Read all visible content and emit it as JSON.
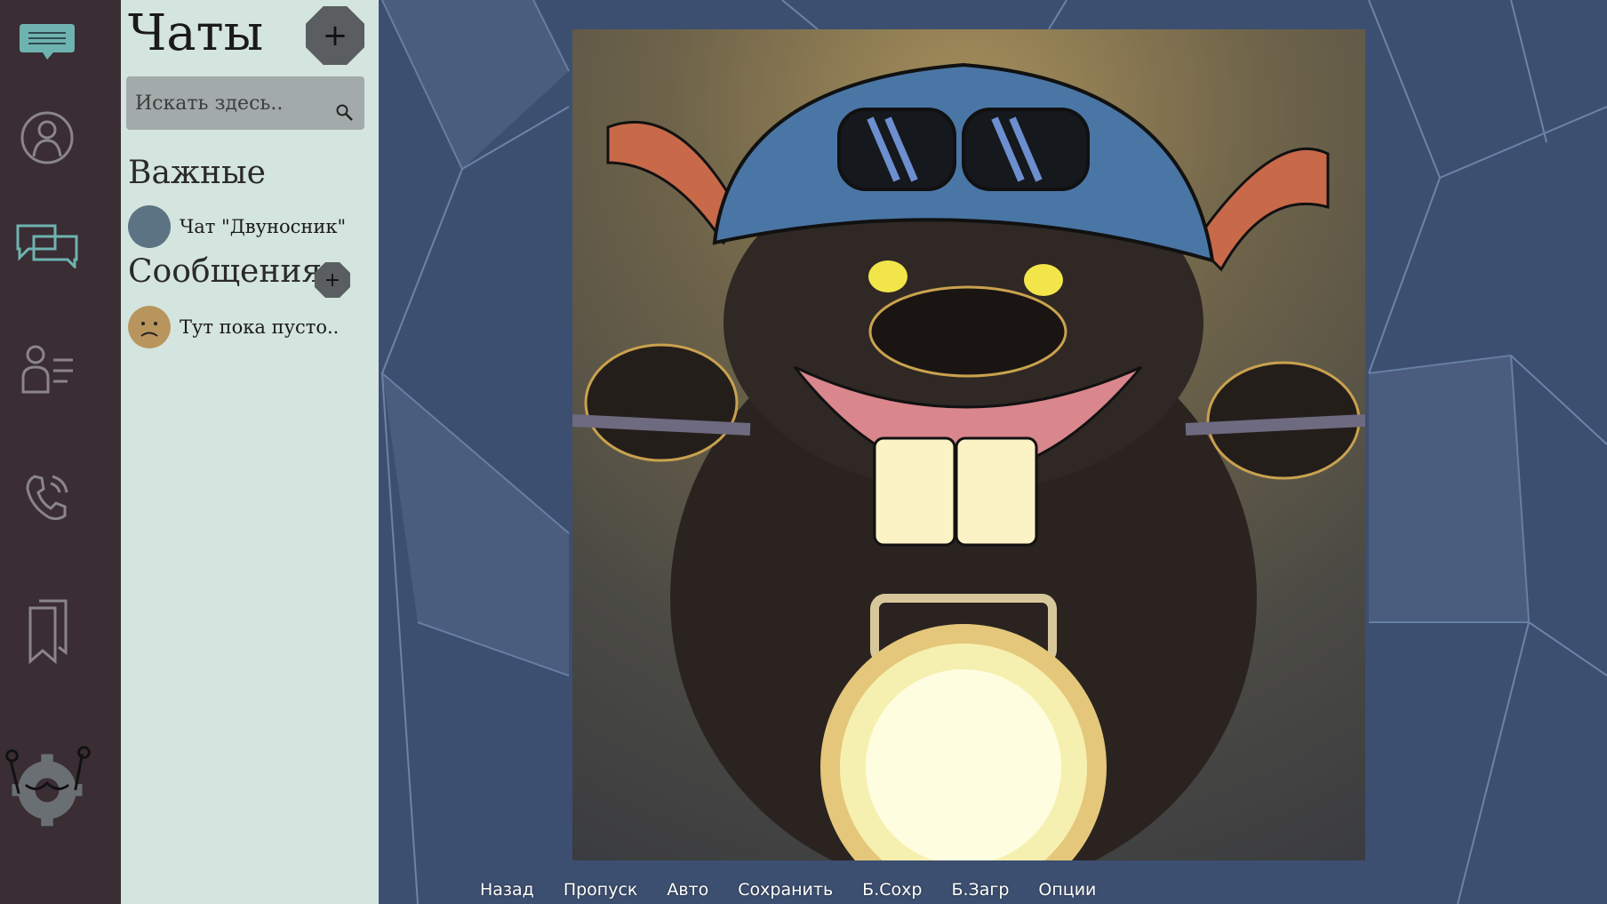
{
  "panel": {
    "title": "Чаты",
    "add_chat_symbol": "+",
    "search_placeholder": "Искать здесь.."
  },
  "sections": {
    "important": {
      "title": "Важные",
      "items": [
        {
          "label": "Чат \"Двуносник\""
        }
      ]
    },
    "messages": {
      "title": "Сообщения",
      "add_symbol": "+",
      "items": [
        {
          "label": "Тут пока пусто.."
        }
      ]
    }
  },
  "rail": {
    "icons": [
      "chat-bubble-icon",
      "profile-icon",
      "conversations-icon",
      "contacts-icon",
      "phone-icon",
      "bookmarks-icon",
      "settings-icon"
    ],
    "active_color": "#6fb3b0"
  },
  "scene": {
    "icons": [
      "beaver-on-motorcycle-icon"
    ]
  },
  "quick_menu": {
    "buttons": [
      "Назад",
      "Пропуск",
      "Авто",
      "Сохранить",
      "Б.Сохр",
      "Б.Загр",
      "Опции"
    ]
  },
  "colors": {
    "rail_bg": "#3a2d33",
    "panel_bg": "#d4e4df",
    "background": "#3d4f70",
    "important_avatar": "#5b7382",
    "empty_avatar": "#b8955c"
  }
}
